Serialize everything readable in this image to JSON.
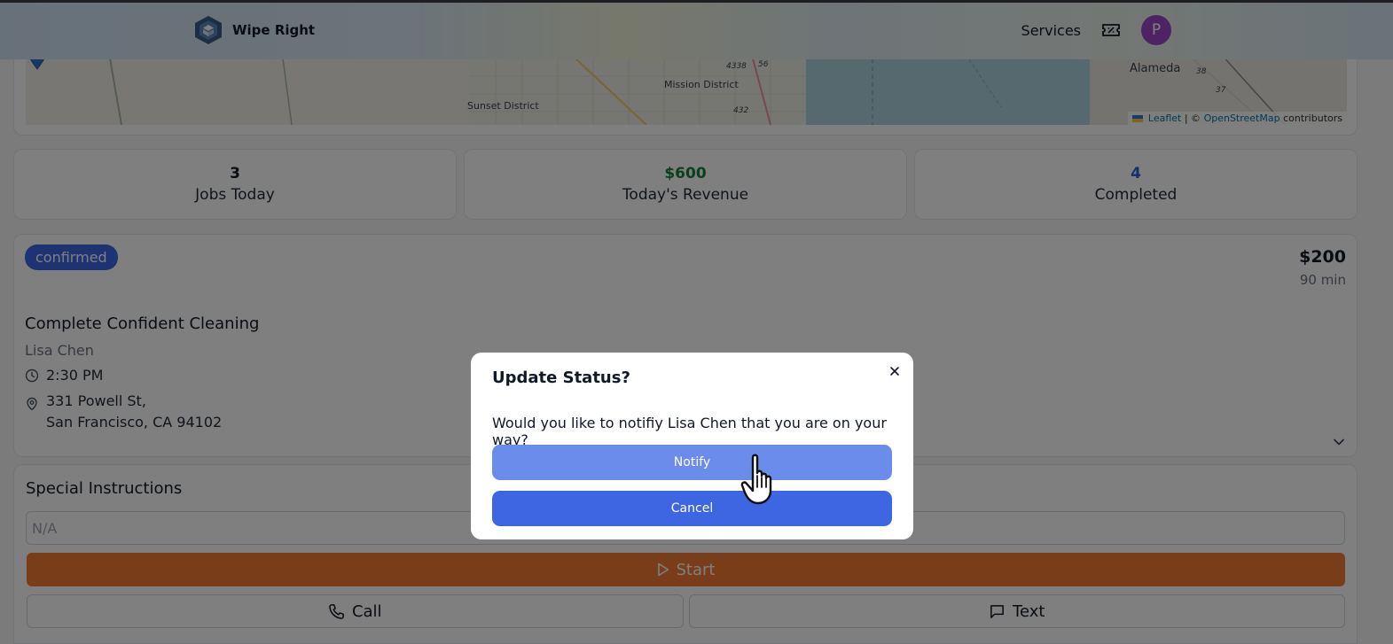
{
  "header": {
    "brand_name": "Wipe Right",
    "nav_services": "Services",
    "avatar_initial": "P",
    "logo_icon": "wipe-right-logo-icon",
    "ticket_icon": "ticket-icon"
  },
  "map": {
    "labels": {
      "sunset": "Sunset District",
      "mission": "Mission District",
      "alameda": "Alameda",
      "road1": "4338",
      "road2": "56",
      "road3": "432",
      "road4": "38",
      "road5": "37"
    },
    "attribution": {
      "leaflet": "Leaflet",
      "sep": "| ©",
      "osm": "OpenStreetMap",
      "contributors": "contributors"
    }
  },
  "stats": [
    {
      "value": "3",
      "label": "Jobs Today",
      "color": "#111827"
    },
    {
      "value": "$600",
      "label": "Today's Revenue",
      "color": "#15803d"
    },
    {
      "value": "4",
      "label": "Completed",
      "color": "#2f5bd3"
    }
  ],
  "job": {
    "status": "confirmed",
    "price": "$200",
    "duration": "90 min",
    "service": "Complete Confident Cleaning",
    "customer": "Lisa Chen",
    "time": "2:30 PM",
    "address_line1": "331 Powell St,",
    "address_line2": "San Francisco, CA 94102"
  },
  "instructions": {
    "title": "Special Instructions",
    "value": "N/A"
  },
  "actions": {
    "start": "Start",
    "call": "Call",
    "text": "Text"
  },
  "modal": {
    "title": "Update Status?",
    "message": "Would you like to notifiy Lisa Chen that you are on your way?",
    "notify": "Notify",
    "cancel": "Cancel"
  },
  "colors": {
    "accent": "#3b67e5",
    "start": "#f47a33",
    "avatar": "#9d46c7"
  }
}
